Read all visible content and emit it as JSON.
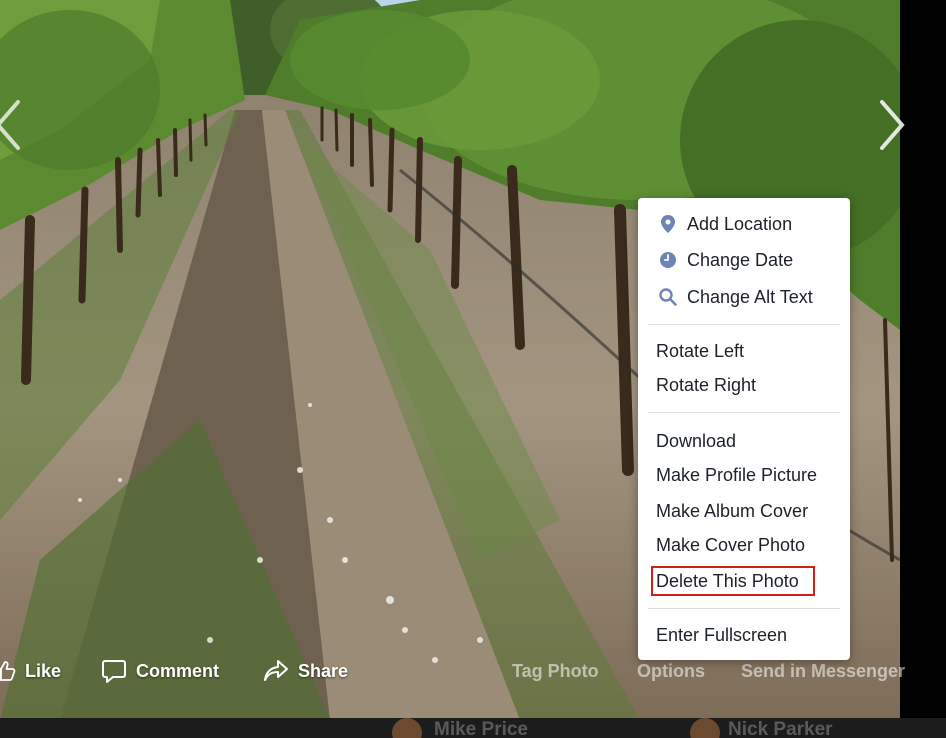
{
  "viewer": {
    "prev_arrow_icon": "chevron-left-icon",
    "next_arrow_icon": "chevron-right-icon"
  },
  "action_bar": {
    "like_label": "Like",
    "comment_label": "Comment",
    "share_label": "Share",
    "tag_photo_label": "Tag Photo",
    "options_label": "Options",
    "send_label": "Send in Messenger"
  },
  "options_menu": {
    "items": [
      {
        "label": "Add Location",
        "icon": "location-pin-icon"
      },
      {
        "label": "Change Date",
        "icon": "clock-icon"
      },
      {
        "label": "Change Alt Text",
        "icon": "search-icon"
      },
      {
        "label": "Rotate Left"
      },
      {
        "label": "Rotate Right"
      },
      {
        "label": "Download"
      },
      {
        "label": "Make Profile Picture"
      },
      {
        "label": "Make Album Cover"
      },
      {
        "label": "Make Cover Photo"
      },
      {
        "label": "Delete This Photo",
        "highlighted": true
      },
      {
        "label": "Enter Fullscreen"
      }
    ],
    "highlight_color": "#d0201a"
  },
  "bottom_strip": {
    "names": [
      "Mike Price",
      "Nick Parker"
    ]
  },
  "colors": {
    "menu_text": "#1d2129",
    "menu_icon": "#6d84b4",
    "separator": "#dadde1"
  }
}
